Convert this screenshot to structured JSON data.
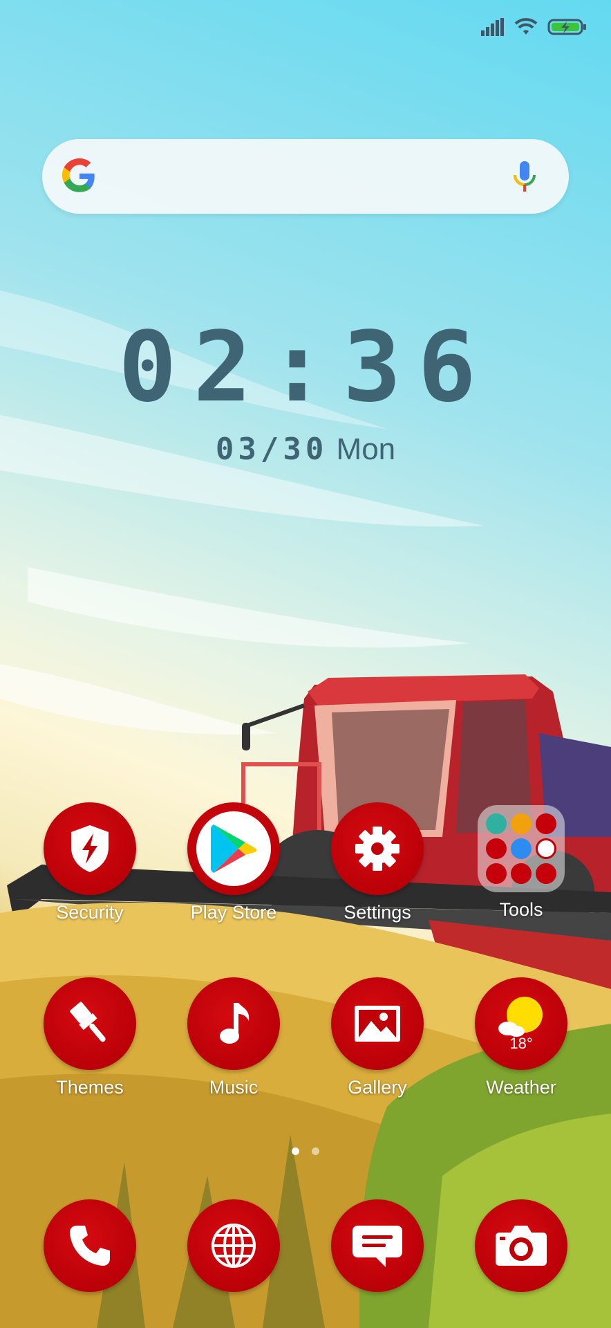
{
  "status_bar": {
    "signal_icon": "signal-icon",
    "wifi_icon": "wifi-icon",
    "battery_icon": "battery-charging-icon",
    "battery_color": "#3cc43c"
  },
  "search_bar": {
    "logo_icon": "google-g-icon",
    "mic_icon": "microphone-icon"
  },
  "clock": {
    "time": "02:36",
    "date_numeric": "03/30",
    "weekday": "Mon"
  },
  "apps_row1": [
    {
      "label": "Security",
      "icon": "shield-lightning-icon"
    },
    {
      "label": "Play Store",
      "icon": "play-store-icon"
    },
    {
      "label": "Settings",
      "icon": "gear-icon"
    },
    {
      "label": "Tools",
      "icon": "folder-icon"
    }
  ],
  "apps_row2": [
    {
      "label": "Themes",
      "icon": "paintbrush-icon"
    },
    {
      "label": "Music",
      "icon": "music-note-icon"
    },
    {
      "label": "Gallery",
      "icon": "image-icon"
    },
    {
      "label": "Weather",
      "icon": "sun-cloud-icon",
      "temperature": "18°"
    }
  ],
  "page_indicator": {
    "pages": 2,
    "current": 1
  },
  "dock": [
    {
      "icon": "phone-icon"
    },
    {
      "icon": "globe-icon"
    },
    {
      "icon": "message-icon"
    },
    {
      "icon": "camera-icon"
    }
  ],
  "colors": {
    "app_red": "#c00008",
    "text_dark": "#3f6474",
    "sky": "#63d9f0"
  }
}
